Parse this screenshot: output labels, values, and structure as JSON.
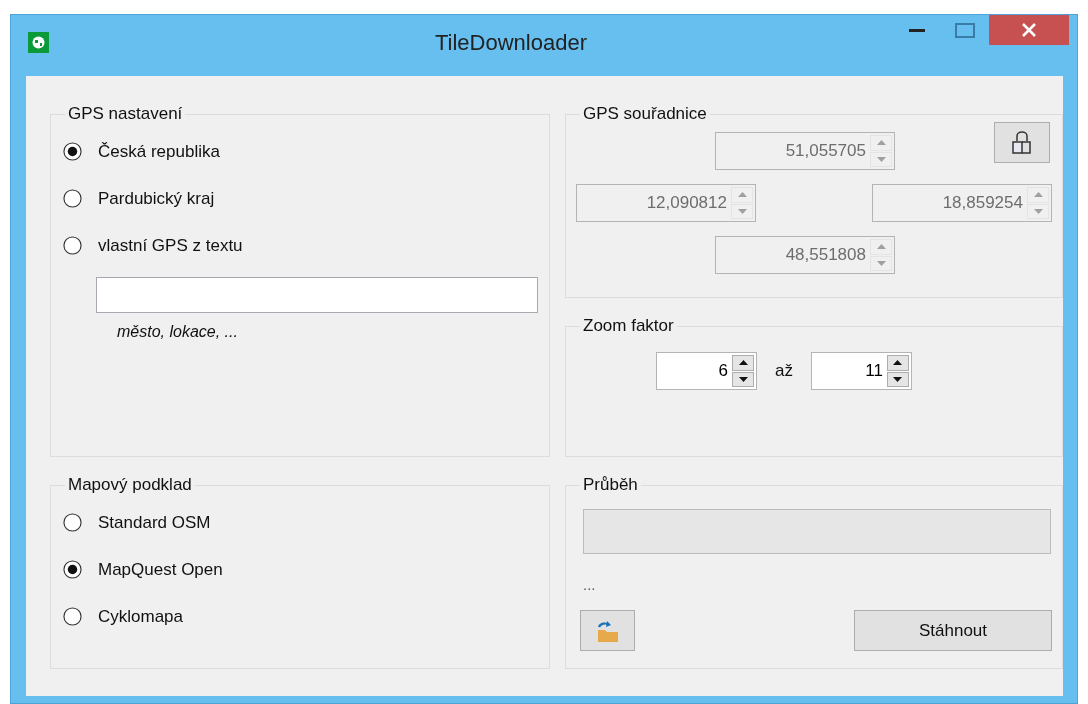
{
  "window": {
    "title": "TileDownloader"
  },
  "gps_settings": {
    "title": "GPS nastavení",
    "options": [
      {
        "label": "Česká republika",
        "selected": true
      },
      {
        "label": "Pardubický kraj",
        "selected": false
      },
      {
        "label": "vlastní GPS z textu",
        "selected": false
      }
    ],
    "hint": "město, lokace, ..."
  },
  "gps_coordinates": {
    "title": "GPS souřadnice",
    "north": {
      "value": "51,055705",
      "disabled": true
    },
    "west": {
      "value": "12,090812",
      "disabled": true
    },
    "east": {
      "value": "18,859254",
      "disabled": true
    },
    "south": {
      "value": "48,551808",
      "disabled": true
    }
  },
  "zoom": {
    "title": "Zoom faktor",
    "from": {
      "value": "6",
      "disabled": false
    },
    "separator": "až",
    "to": {
      "value": "11",
      "disabled": false
    }
  },
  "map_source": {
    "title": "Mapový podklad",
    "options": [
      {
        "label": "Standard OSM",
        "selected": false
      },
      {
        "label": "MapQuest Open",
        "selected": true
      },
      {
        "label": "Cyklomapa",
        "selected": false
      }
    ]
  },
  "progress": {
    "title": "Průběh",
    "level": 0,
    "status": "...",
    "download_button": "Stáhnout"
  }
}
